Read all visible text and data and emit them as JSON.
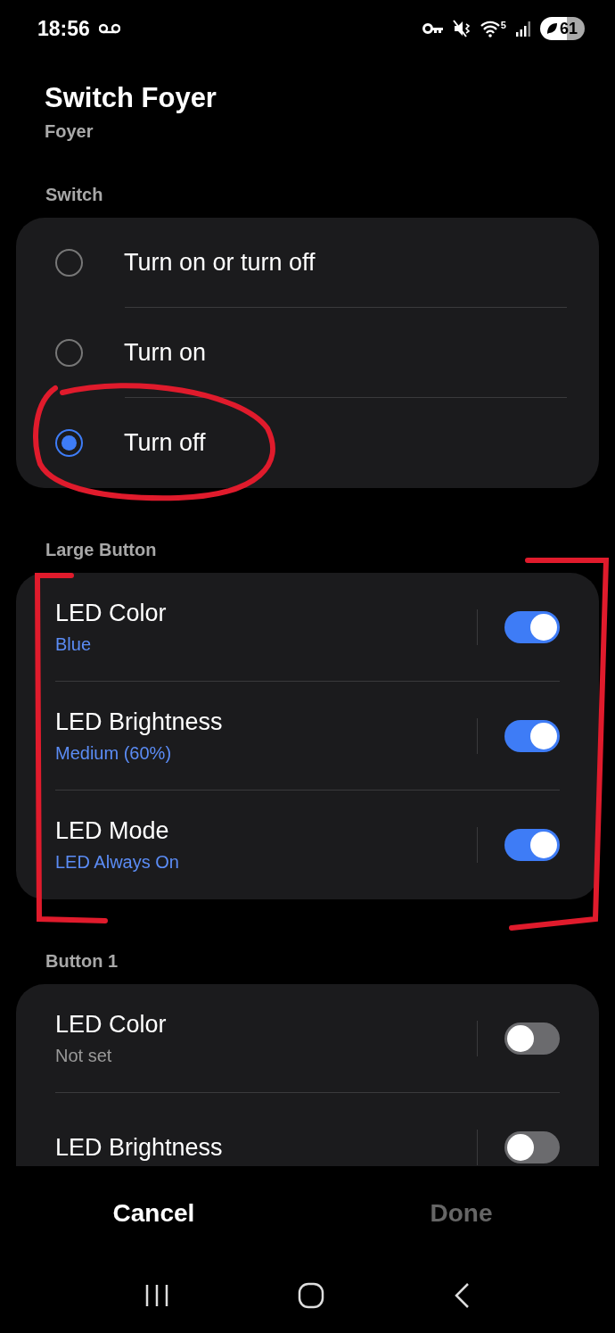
{
  "status_bar": {
    "time": "18:56",
    "wifi_band": "5",
    "battery": "61"
  },
  "header": {
    "title": "Switch Foyer",
    "subtitle": "Foyer"
  },
  "sections": [
    {
      "label": "Switch",
      "kind": "radio",
      "items": [
        {
          "label": "Turn on or turn off",
          "selected": false
        },
        {
          "label": "Turn on",
          "selected": false
        },
        {
          "label": "Turn off",
          "selected": true
        }
      ]
    },
    {
      "label": "Large Button",
      "kind": "toggle",
      "items": [
        {
          "label": "LED Color",
          "value": "Blue",
          "on": true
        },
        {
          "label": "LED Brightness",
          "value": "Medium (60%)",
          "on": true
        },
        {
          "label": "LED Mode",
          "value": "LED Always On",
          "on": true
        }
      ]
    },
    {
      "label": "Button 1",
      "kind": "toggle",
      "items": [
        {
          "label": "LED Color",
          "value": "Not set",
          "on": false
        },
        {
          "label": "LED Brightness",
          "on": false
        }
      ]
    }
  ],
  "actions": [
    {
      "label": "Cancel",
      "disabled": false
    },
    {
      "label": "Done",
      "disabled": true
    }
  ]
}
